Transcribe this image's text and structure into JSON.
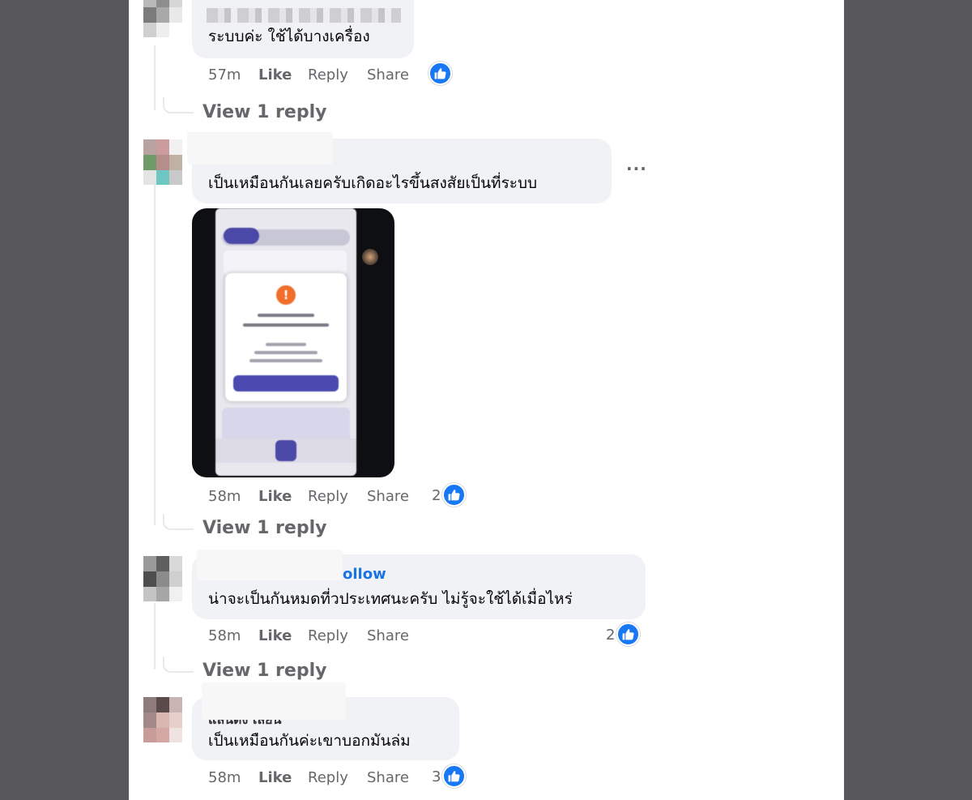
{
  "colors": {
    "backdrop": "#58585a",
    "panel": "#ffffff",
    "bubble": "#f0f2f5",
    "like_blue": "#1877f2",
    "muted_text": "#65676b",
    "follow_blue": "#1b74e4"
  },
  "actions": {
    "like": "Like",
    "reply": "Reply",
    "share": "Share"
  },
  "icons": {
    "reaction": "like-thumbs-up-icon",
    "more": "more-horizontal-icon"
  },
  "comments": [
    {
      "text": "ระบบค่ะ ใช้ได้บางเครื่อง",
      "time": "57m",
      "reaction_count": "",
      "view_replies": "View 1 reply"
    },
    {
      "text": "เป็นเหมือนกันเลยครับเกิดอะไรขึ้นสงสัยเป็นที่ระบบ",
      "more": "···",
      "has_photo": true,
      "time": "58m",
      "reaction_count": "2",
      "view_replies": "View 1 reply"
    },
    {
      "follow": "ollow",
      "text": "น่าจะเป็นกันหมดที่วประเทศนะครับ ไม่รู้จะใช้ได้เมื่อไหร่",
      "time": "58m",
      "reaction_count": "2",
      "view_replies": "View 1 reply"
    },
    {
      "name_fragment": "แลนิดง เลียน",
      "text": "เป็นเหมือนกันค่ะเขาบอกมันล่ม",
      "time": "58m",
      "reaction_count": "3"
    }
  ]
}
